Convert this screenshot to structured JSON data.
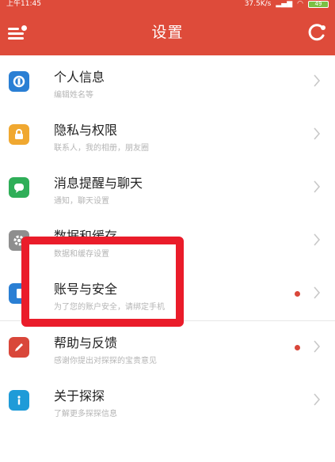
{
  "status_bar": {
    "time": "上午11:45",
    "network": "37.5K/s",
    "battery": "49"
  },
  "header": {
    "title": "设置"
  },
  "settings": [
    {
      "title": "个人信息",
      "subtitle": "编辑姓名等",
      "icon": "person-icon",
      "color": "#2a7fd4",
      "badge": false
    },
    {
      "title": "隐私与权限",
      "subtitle": "联系人，我的相册，朋友圈",
      "icon": "lock-icon",
      "color": "#f0a830",
      "badge": false
    },
    {
      "title": "消息提醒与聊天",
      "subtitle": "通知，聊天设置",
      "icon": "chat-icon",
      "color": "#2fae58",
      "badge": false
    },
    {
      "title": "数据和缓存",
      "subtitle": "数据和缓存设置",
      "icon": "gear-icon",
      "color": "#8e8e8e",
      "badge": false
    },
    {
      "title": "账号与安全",
      "subtitle": "为了您的账户安全，请绑定手机",
      "icon": "phone-icon",
      "color": "#2a7fd4",
      "badge": true
    },
    {
      "title": "帮助与反馈",
      "subtitle": "感谢你提出对探探的宝贵意见",
      "icon": "pencil-icon",
      "color": "#d9473a",
      "badge": true
    },
    {
      "title": "关于探探",
      "subtitle": "了解更多探探信息",
      "icon": "info-icon",
      "color": "#1f9bd8",
      "badge": false
    }
  ]
}
